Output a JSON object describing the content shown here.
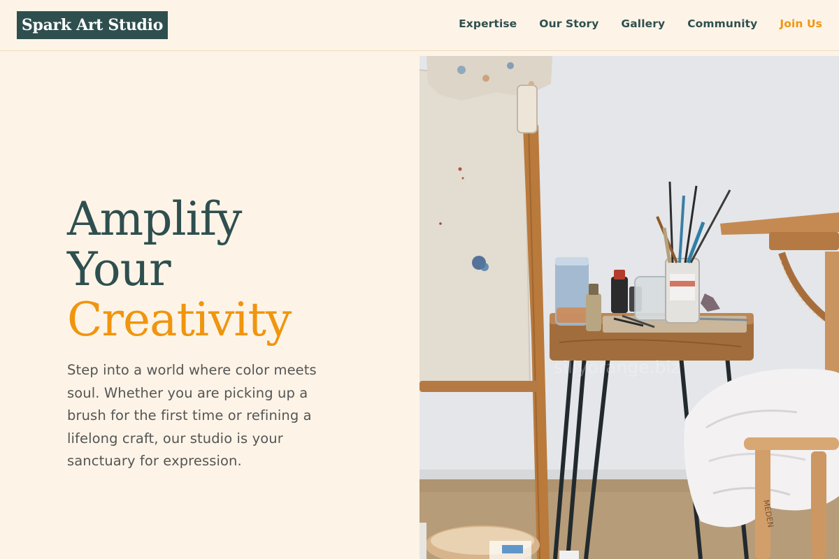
{
  "header": {
    "logo": "Spark Art Studio",
    "nav": [
      {
        "label": "Expertise"
      },
      {
        "label": "Our Story"
      },
      {
        "label": "Gallery"
      },
      {
        "label": "Community"
      },
      {
        "label": "Join Us"
      }
    ]
  },
  "hero": {
    "title_line1": "Amplify",
    "title_line2": "Your",
    "title_line3": "Creativity",
    "description": "Step into a world where color meets soul. Whether you are picking up a brush for the first time or refining a lifelong craft, our studio is your sanctuary for expression.",
    "image": {
      "subject": "art-studio-photo",
      "watermark": "sillyorange.biz",
      "stool_label": "MEDEN"
    }
  },
  "colors": {
    "background": "#fdf4e7",
    "primary": "#2f4f4f",
    "accent": "#f0950f",
    "body_text": "#555555"
  }
}
